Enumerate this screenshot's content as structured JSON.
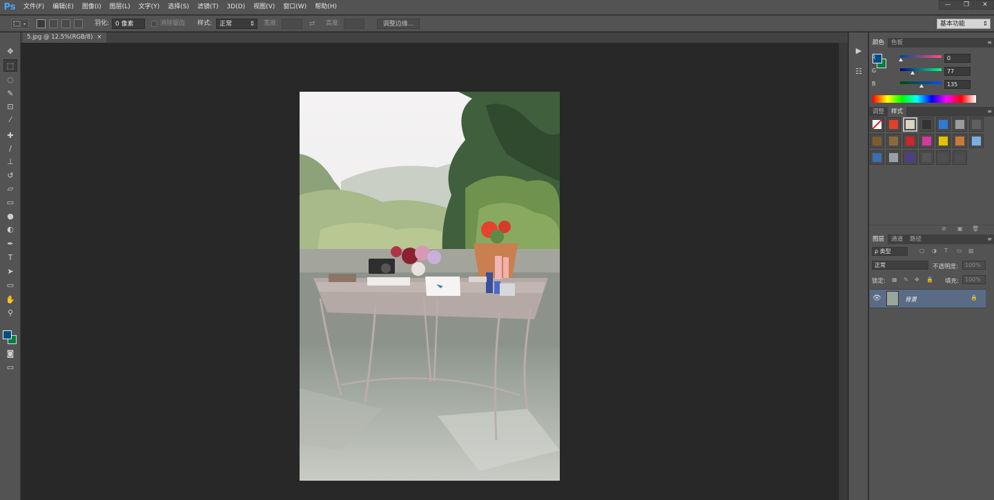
{
  "app": {
    "logo": "Ps"
  },
  "menu": [
    "文件(F)",
    "编辑(E)",
    "图像(I)",
    "图层(L)",
    "文字(Y)",
    "选择(S)",
    "滤镜(T)",
    "3D(D)",
    "视图(V)",
    "窗口(W)",
    "帮助(H)"
  ],
  "window_controls": {
    "minimize": "—",
    "restore": "❐",
    "close": "✕"
  },
  "options": {
    "feather_label": "羽化:",
    "feather_value": "0 像素",
    "antialias_label": "消除锯齿",
    "style_label": "样式:",
    "style_value": "正常",
    "width_label": "宽度:",
    "height_label": "高度:",
    "refine_edge": "调整边缘...",
    "workspace": "基本功能"
  },
  "document": {
    "tab_title": "5.jpg @ 12.5%(RGB/8)",
    "tab_close": "×"
  },
  "tools": [
    {
      "name": "move-tool",
      "glyph": "✥"
    },
    {
      "name": "marquee-tool",
      "glyph": "⬚"
    },
    {
      "name": "lasso-tool",
      "glyph": "◌"
    },
    {
      "name": "quick-select-tool",
      "glyph": "✎"
    },
    {
      "name": "crop-tool",
      "glyph": "⊡"
    },
    {
      "name": "eyedropper-tool",
      "glyph": "⁄"
    },
    {
      "name": "healing-brush-tool",
      "glyph": "✚"
    },
    {
      "name": "brush-tool",
      "glyph": "∕"
    },
    {
      "name": "clone-stamp-tool",
      "glyph": "⊥"
    },
    {
      "name": "history-brush-tool",
      "glyph": "↺"
    },
    {
      "name": "eraser-tool",
      "glyph": "▱"
    },
    {
      "name": "gradient-tool",
      "glyph": "▭"
    },
    {
      "name": "blur-tool",
      "glyph": "●"
    },
    {
      "name": "dodge-tool",
      "glyph": "◐"
    },
    {
      "name": "pen-tool",
      "glyph": "✒"
    },
    {
      "name": "type-tool",
      "glyph": "T"
    },
    {
      "name": "path-select-tool",
      "glyph": "➤"
    },
    {
      "name": "rectangle-tool",
      "glyph": "▭"
    },
    {
      "name": "hand-tool",
      "glyph": "✋"
    },
    {
      "name": "zoom-tool",
      "glyph": "⚲"
    }
  ],
  "colors": {
    "foreground": "#004d87",
    "background": "#0d7a3e"
  },
  "color_panel": {
    "tabs": [
      "颜色",
      "色板"
    ],
    "r_label": "R",
    "g_label": "G",
    "b_label": "B",
    "r": "0",
    "g": "77",
    "b": "135"
  },
  "styles_panel": {
    "tabs": [
      "调整",
      "样式"
    ]
  },
  "layers_panel": {
    "tabs": [
      "图层",
      "通道",
      "路径"
    ],
    "kind_label": "ρ 类型",
    "blend_mode": "正常",
    "opacity_label": "不透明度:",
    "opacity_value": "100%",
    "lock_label": "锁定:",
    "fill_label": "填充:",
    "fill_value": "100%",
    "layer_name": "背景"
  }
}
